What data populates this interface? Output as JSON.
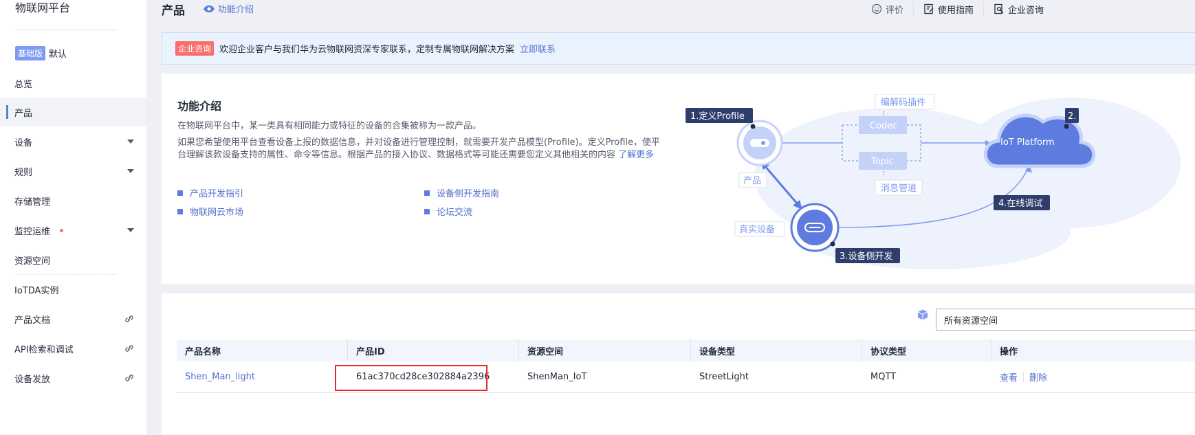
{
  "sidebar": {
    "title": "物联网平台",
    "edition_badge": "基础版",
    "edition_label": "默认",
    "items": [
      {
        "label": "总览"
      },
      {
        "label": "产品"
      },
      {
        "label": "设备"
      },
      {
        "label": "规则"
      },
      {
        "label": "存储管理"
      },
      {
        "label": "监控运维"
      },
      {
        "label": "资源空间"
      },
      {
        "label": "IoTDA实例"
      },
      {
        "label": "产品文档"
      },
      {
        "label": "API检索和调试"
      },
      {
        "label": "设备发放"
      }
    ]
  },
  "header": {
    "title": "产品",
    "intro_link": "功能介绍",
    "actions": [
      {
        "label": "评价"
      },
      {
        "label": "使用指南"
      },
      {
        "label": "企业咨询"
      }
    ]
  },
  "banner": {
    "tag": "企业咨询",
    "text": "欢迎企业客户与我们华为云物联网资深专家联系，定制专属物联网解决方案",
    "link": "立即联系"
  },
  "intro": {
    "title": "功能介绍",
    "p1": "在物联网平台中，某一类具有相同能力或特征的设备的合集被称为一款产品。",
    "p2": "如果您希望使用平台查看设备上报的数据信息，并对设备进行管理控制，就需要开发产品模型(Profile)。定义Profile，使平台理解该款设备支持的属性、命令等信息。根据产品的接入协议、数据格式等可能还需要您定义其他相关的内容",
    "more": "了解更多",
    "links": [
      {
        "label": "产品开发指引"
      },
      {
        "label": "设备侧开发指南"
      },
      {
        "label": "物联网云市场"
      },
      {
        "label": "论坛交流"
      }
    ],
    "diagram": {
      "step1": "1.定义Profile",
      "step2": "2.",
      "step3": "3.设备侧开发",
      "step4": "4.在线调试",
      "codec_plugin": "编解码插件",
      "codec": "Codec",
      "topic": "Topic",
      "msg_pipe": "消息管道",
      "product": "产品",
      "real_device": "真实设备",
      "platform": "IoT Platform"
    }
  },
  "table": {
    "workspace_select": "所有资源空间",
    "columns": [
      "产品名称",
      "产品ID",
      "资源空间",
      "设备类型",
      "协议类型",
      "操作"
    ],
    "rows": [
      {
        "name": "Shen_Man_light",
        "id": "61ac370cd28ce302884a2396",
        "space": "ShenMan_IoT",
        "device_type": "StreetLight",
        "protocol": "MQTT",
        "ops": [
          "查看",
          "删除"
        ]
      }
    ]
  }
}
